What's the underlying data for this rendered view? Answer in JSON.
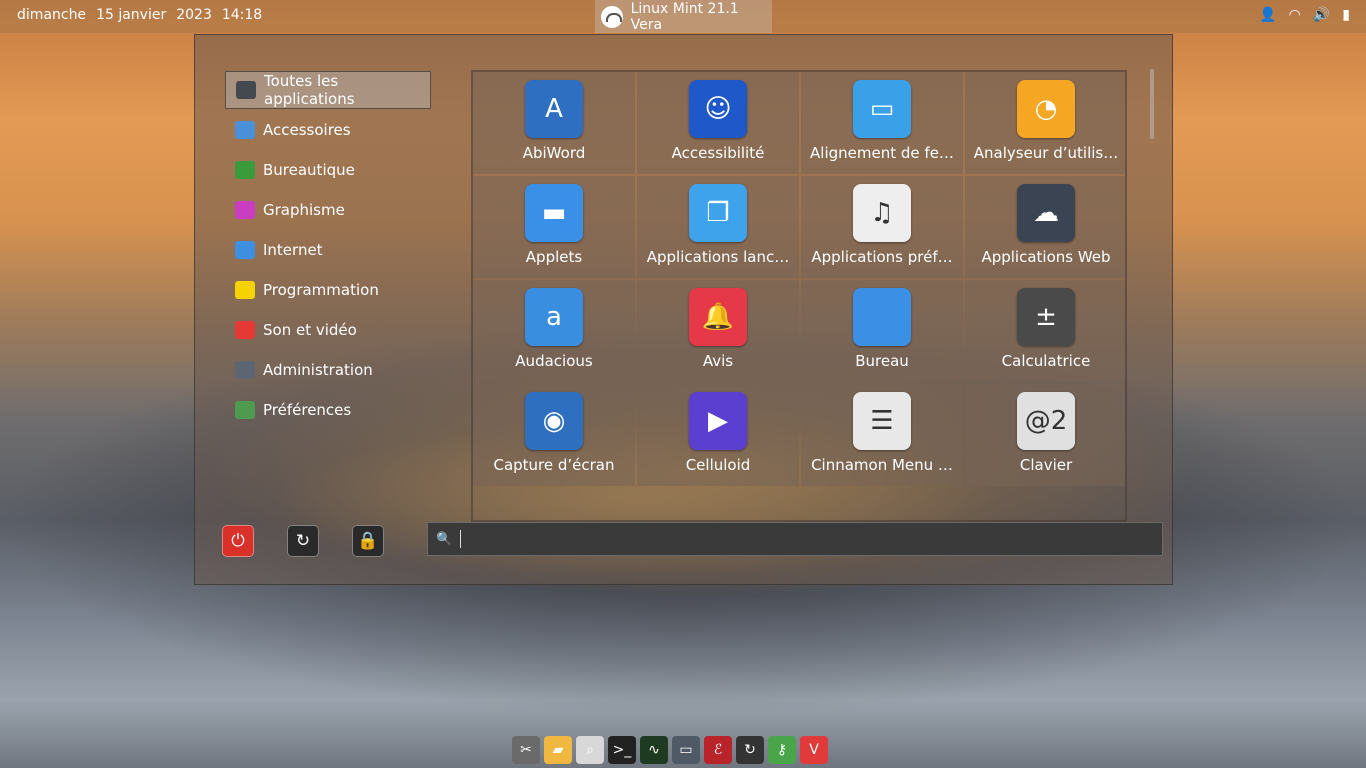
{
  "panel": {
    "day": "dimanche",
    "date": "15 janvier",
    "year": "2023",
    "time": "14:18",
    "window_title": "Linux Mint  21.1 Vera"
  },
  "categories": [
    {
      "label": "Toutes les applications",
      "icon": "monitor-icon",
      "color": "#44494f"
    },
    {
      "label": "Accessoires",
      "icon": "scissors-icon",
      "color": "#4a90d9"
    },
    {
      "label": "Bureautique",
      "icon": "office-icon",
      "color": "#3a9a3c"
    },
    {
      "label": "Graphisme",
      "icon": "palette-icon",
      "color": "#c93dc0"
    },
    {
      "label": "Internet",
      "icon": "cloud-icon",
      "color": "#3d8fe0"
    },
    {
      "label": "Programmation",
      "icon": "code-icon",
      "color": "#f5d200"
    },
    {
      "label": "Son et vidéo",
      "icon": "play-icon",
      "color": "#e53935"
    },
    {
      "label": "Administration",
      "icon": "gear-icon",
      "color": "#5c6670"
    },
    {
      "label": "Préférences",
      "icon": "toggles-icon",
      "color": "#4e9a4e"
    }
  ],
  "apps": [
    {
      "label": "AbiWord",
      "icon": "abiword-icon",
      "bg": "#2e6fc2",
      "glyph": "A"
    },
    {
      "label": "Accessibilité",
      "icon": "accessibility-icon",
      "bg": "#1f58c8",
      "glyph": "☺"
    },
    {
      "label": "Alignement de fe…",
      "icon": "window-align-icon",
      "bg": "#3aa0e8",
      "glyph": "▭"
    },
    {
      "label": "Analyseur d’utilis…",
      "icon": "disk-usage-icon",
      "bg": "#f5a623",
      "glyph": "◔"
    },
    {
      "label": "Applets",
      "icon": "applets-icon",
      "bg": "#3a8fe6",
      "glyph": "▬"
    },
    {
      "label": "Applications lanc…",
      "icon": "startup-apps-icon",
      "bg": "#3fa3ec",
      "glyph": "❐"
    },
    {
      "label": "Applications préf…",
      "icon": "preferred-apps-icon",
      "bg": "#eeeeee",
      "glyph": "♫"
    },
    {
      "label": "Applications Web",
      "icon": "web-apps-icon",
      "bg": "#3b4452",
      "glyph": "☁"
    },
    {
      "label": "Audacious",
      "icon": "audacious-icon",
      "bg": "#3a8ee0",
      "glyph": "a"
    },
    {
      "label": "Avis",
      "icon": "bell-icon",
      "bg": "#e53949",
      "glyph": "🔔"
    },
    {
      "label": "Bureau",
      "icon": "desktop-icon",
      "bg": "#3b8fe4",
      "glyph": ""
    },
    {
      "label": "Calculatrice",
      "icon": "calculator-icon",
      "bg": "#4a4a4a",
      "glyph": "±"
    },
    {
      "label": "Capture d’écran",
      "icon": "camera-icon",
      "bg": "#2f6fc0",
      "glyph": "◉"
    },
    {
      "label": "Celluloid",
      "icon": "celluloid-icon",
      "bg": "#5a3fd0",
      "glyph": "▶"
    },
    {
      "label": "Cinnamon Menu …",
      "icon": "menu-editor-icon",
      "bg": "#e8e8e8",
      "glyph": "☰"
    },
    {
      "label": "Clavier",
      "icon": "keyboard-icon",
      "bg": "#e0e0e0",
      "glyph": "@2"
    }
  ],
  "session_buttons": [
    {
      "name": "power-button",
      "icon": "power-icon",
      "color": "#d9302a",
      "glyph": "⏻"
    },
    {
      "name": "logout-button",
      "icon": "logout-icon",
      "color": "#2a2a2a",
      "glyph": "↻"
    },
    {
      "name": "lock-button",
      "icon": "lock-icon",
      "color": "#2a2a2a",
      "glyph": "🔒"
    }
  ],
  "search": {
    "placeholder": "",
    "value": ""
  },
  "dock": [
    {
      "icon": "scissors-icon",
      "color": "#6a6a6a",
      "glyph": "✂"
    },
    {
      "icon": "folder-icon",
      "color": "#f0b840",
      "glyph": "▰"
    },
    {
      "icon": "magnifier-icon",
      "color": "#d8d8d8",
      "glyph": "⌕"
    },
    {
      "icon": "terminal-icon",
      "color": "#222222",
      "glyph": ">_"
    },
    {
      "icon": "system-monitor-icon",
      "color": "#1e3a20",
      "glyph": "∿"
    },
    {
      "icon": "display-icon",
      "color": "#4f5a66",
      "glyph": "▭"
    },
    {
      "icon": "text-editor-icon",
      "color": "#b8242a",
      "glyph": "ℰ"
    },
    {
      "icon": "update-icon",
      "color": "#333333",
      "glyph": "↻"
    },
    {
      "icon": "key-icon",
      "color": "#4aa54a",
      "glyph": "⚷"
    },
    {
      "icon": "vivaldi-icon",
      "color": "#e03a3a",
      "glyph": "V"
    }
  ]
}
